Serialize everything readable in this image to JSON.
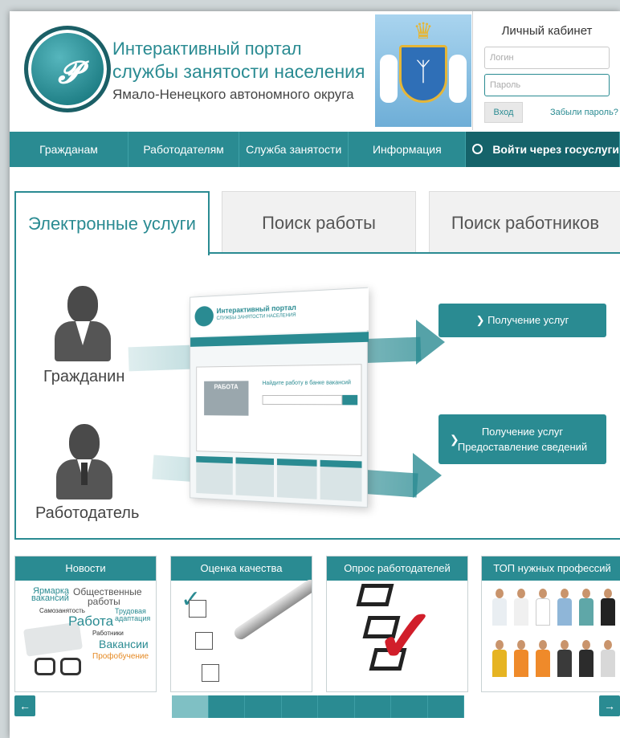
{
  "header": {
    "title_line1": "Интерактивный портал",
    "title_line2": "службы занятости населения",
    "title_line3": "Ямало-Ненецкого автономного округа"
  },
  "cabinet": {
    "title": "Личный кабинет",
    "login_placeholder": "Логин",
    "password_placeholder": "Пароль",
    "enter_label": "Вход",
    "forgot_label": "Забыли пароль?"
  },
  "nav": {
    "items": [
      "Гражданам",
      "Работодателям",
      "Служба занятости",
      "Информация"
    ],
    "gosuslugi": "Войти через госуслуги"
  },
  "tabs": [
    {
      "label": "Электронные услуги",
      "active": true
    },
    {
      "label": "Поиск работы",
      "active": false
    },
    {
      "label": "Поиск работников",
      "active": false
    }
  ],
  "content": {
    "citizen_label": "Гражданин",
    "employer_label": "Работодатель",
    "service_1": "Получение услуг",
    "service_2_line1": "Получение услуг",
    "service_2_line2": "Предоставление сведений",
    "preview": {
      "title": "Интерактивный портал",
      "subtitle": "СЛУЖБЫ ЗАНЯТОСТИ НАСЕЛЕНИЯ",
      "work_label": "РАБОТА",
      "find_text": "Найдите работу в банке вакансий"
    }
  },
  "cards": [
    {
      "title": "Новости"
    },
    {
      "title": "Оценка качества"
    },
    {
      "title": "Опрос работодателей"
    },
    {
      "title": "ТОП нужных профессий"
    }
  ],
  "news_cloud": [
    "Ярмарка",
    "вакансий",
    "Общественные",
    "работы",
    "Самозанятость",
    "Трудовая",
    "адаптация",
    "Работа",
    "Работники",
    "Вакансии",
    "Профобучение"
  ],
  "pager": {
    "prev": "←",
    "next": "→",
    "pages": 8,
    "active_page": 1
  },
  "colors": {
    "accent": "#2a8b92",
    "accent_dark": "#15636a",
    "check_red": "#d11e2a"
  }
}
